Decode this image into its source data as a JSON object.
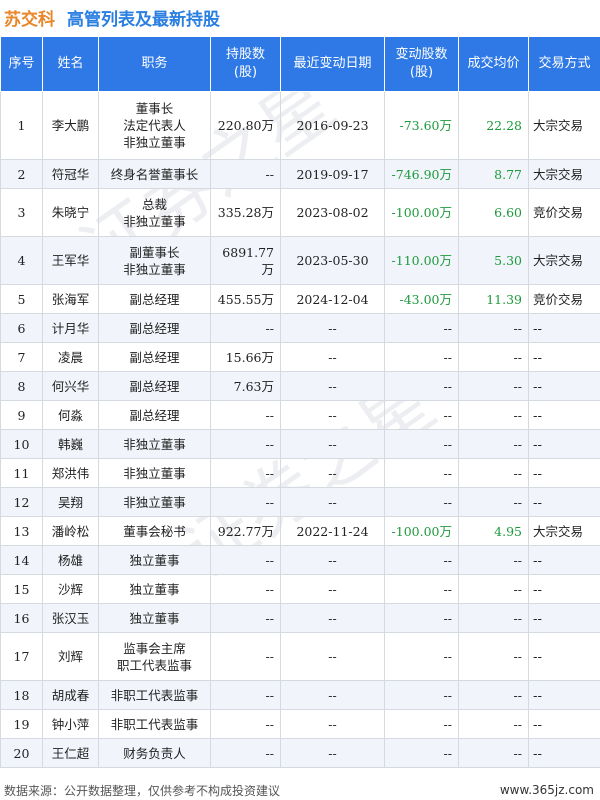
{
  "header": {
    "company": "苏交科",
    "title": "高管列表及最新持股"
  },
  "table": {
    "columns": [
      "序号",
      "姓名",
      "职务",
      "持股数\n(股)",
      "最近变动日期",
      "变动股数\n(股)",
      "成交均价",
      "交易方式"
    ],
    "rows": [
      {
        "no": "1",
        "name": "李大鹏",
        "roles": [
          "董事长",
          "法定代表人",
          "非独立董事"
        ],
        "shares": "220.80万",
        "date": "2016-09-23",
        "change": "-73.60万",
        "price": "22.28",
        "method": "大宗交易"
      },
      {
        "no": "2",
        "name": "符冠华",
        "roles": [
          "终身名誉董事长"
        ],
        "shares": "--",
        "date": "2019-09-17",
        "change": "-746.90万",
        "price": "8.77",
        "method": "大宗交易"
      },
      {
        "no": "3",
        "name": "朱晓宁",
        "roles": [
          "总裁",
          "非独立董事"
        ],
        "shares": "335.28万",
        "date": "2023-08-02",
        "change": "-100.00万",
        "price": "6.60",
        "method": "竞价交易"
      },
      {
        "no": "4",
        "name": "王军华",
        "roles": [
          "副董事长",
          "非独立董事"
        ],
        "shares": "6891.77万",
        "date": "2023-05-30",
        "change": "-110.00万",
        "price": "5.30",
        "method": "大宗交易"
      },
      {
        "no": "5",
        "name": "张海军",
        "roles": [
          "副总经理"
        ],
        "shares": "455.55万",
        "date": "2024-12-04",
        "change": "-43.00万",
        "price": "11.39",
        "method": "竞价交易"
      },
      {
        "no": "6",
        "name": "计月华",
        "roles": [
          "副总经理"
        ],
        "shares": "--",
        "date": "--",
        "change": "--",
        "price": "--",
        "method": "--"
      },
      {
        "no": "7",
        "name": "凌晨",
        "roles": [
          "副总经理"
        ],
        "shares": "15.66万",
        "date": "--",
        "change": "--",
        "price": "--",
        "method": "--"
      },
      {
        "no": "8",
        "name": "何兴华",
        "roles": [
          "副总经理"
        ],
        "shares": "7.63万",
        "date": "--",
        "change": "--",
        "price": "--",
        "method": "--"
      },
      {
        "no": "9",
        "name": "何淼",
        "roles": [
          "副总经理"
        ],
        "shares": "--",
        "date": "--",
        "change": "--",
        "price": "--",
        "method": "--"
      },
      {
        "no": "10",
        "name": "韩巍",
        "roles": [
          "非独立董事"
        ],
        "shares": "--",
        "date": "--",
        "change": "--",
        "price": "--",
        "method": "--"
      },
      {
        "no": "11",
        "name": "郑洪伟",
        "roles": [
          "非独立董事"
        ],
        "shares": "--",
        "date": "--",
        "change": "--",
        "price": "--",
        "method": "--"
      },
      {
        "no": "12",
        "name": "吴翔",
        "roles": [
          "非独立董事"
        ],
        "shares": "--",
        "date": "--",
        "change": "--",
        "price": "--",
        "method": "--"
      },
      {
        "no": "13",
        "name": "潘岭松",
        "roles": [
          "董事会秘书"
        ],
        "shares": "922.77万",
        "date": "2022-11-24",
        "change": "-100.00万",
        "price": "4.95",
        "method": "大宗交易"
      },
      {
        "no": "14",
        "name": "杨雄",
        "roles": [
          "独立董事"
        ],
        "shares": "--",
        "date": "--",
        "change": "--",
        "price": "--",
        "method": "--"
      },
      {
        "no": "15",
        "name": "沙辉",
        "roles": [
          "独立董事"
        ],
        "shares": "--",
        "date": "--",
        "change": "--",
        "price": "--",
        "method": "--"
      },
      {
        "no": "16",
        "name": "张汉玉",
        "roles": [
          "独立董事"
        ],
        "shares": "--",
        "date": "--",
        "change": "--",
        "price": "--",
        "method": "--"
      },
      {
        "no": "17",
        "name": "刘辉",
        "roles": [
          "监事会主席",
          "职工代表监事"
        ],
        "shares": "--",
        "date": "--",
        "change": "--",
        "price": "--",
        "method": "--"
      },
      {
        "no": "18",
        "name": "胡成春",
        "roles": [
          "非职工代表监事"
        ],
        "shares": "--",
        "date": "--",
        "change": "--",
        "price": "--",
        "method": "--"
      },
      {
        "no": "19",
        "name": "钟小萍",
        "roles": [
          "非职工代表监事"
        ],
        "shares": "--",
        "date": "--",
        "change": "--",
        "price": "--",
        "method": "--"
      },
      {
        "no": "20",
        "name": "王仁超",
        "roles": [
          "财务负责人"
        ],
        "shares": "--",
        "date": "--",
        "change": "--",
        "price": "--",
        "method": "--"
      }
    ]
  },
  "footer": {
    "source": "数据来源：公开数据整理，仅供参考不构成投资建议",
    "site": "www.365jz.com"
  },
  "colors": {
    "company": "#e8862a",
    "title": "#2a7fe0",
    "header_bg": "#2f79e6",
    "negative": "#1e9a3c",
    "zebra": "#f1f5fb"
  }
}
